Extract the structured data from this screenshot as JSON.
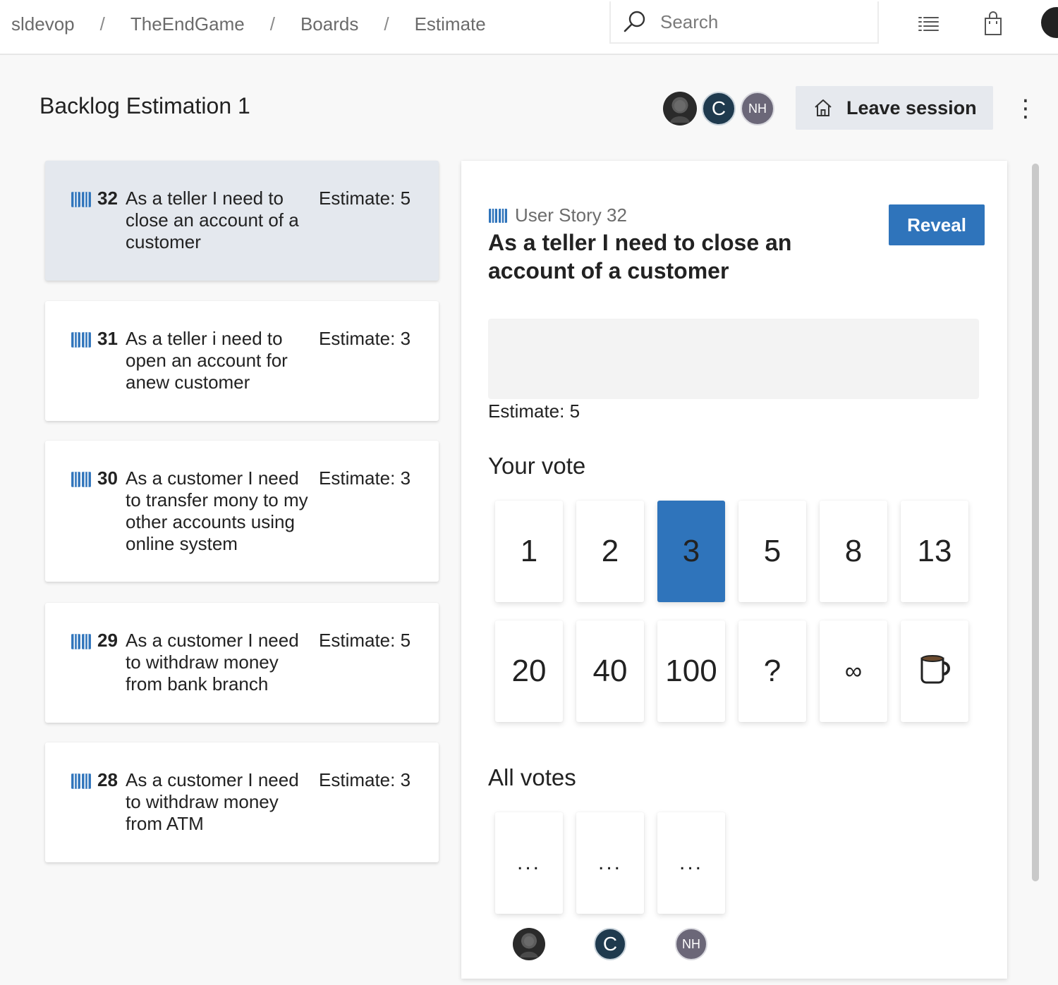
{
  "breadcrumb": [
    "sldevop",
    "TheEndGame",
    "Boards",
    "Estimate"
  ],
  "search": {
    "placeholder": "Search"
  },
  "topbar_icons": [
    "list-icon",
    "shopping-bag-icon",
    "user-avatar"
  ],
  "session": {
    "title": "Backlog Estimation 1",
    "participants": [
      {
        "type": "photo",
        "initials": ""
      },
      {
        "type": "initials",
        "initials": "C"
      },
      {
        "type": "initials",
        "initials": "NH"
      }
    ],
    "leave_label": "Leave session",
    "more_label": "⋮"
  },
  "backlog": [
    {
      "id": "32",
      "title": "As a teller I need to close an account of a customer",
      "estimate": "Estimate: 5",
      "selected": true
    },
    {
      "id": "31",
      "title": "As a teller i need to open an account for anew customer",
      "estimate": "Estimate: 3",
      "selected": false
    },
    {
      "id": "30",
      "title": "As a customer I need to transfer mony to my other accounts using online system",
      "estimate": "Estimate: 3",
      "selected": false
    },
    {
      "id": "29",
      "title": "As a customer I need to withdraw money from bank branch",
      "estimate": "Estimate: 5",
      "selected": false
    },
    {
      "id": "28",
      "title": "As a customer I need to withdraw money from ATM",
      "estimate": "Estimate: 3",
      "selected": false
    }
  ],
  "detail": {
    "type_label": "User Story 32",
    "title": "As a teller I need to close an account of a customer",
    "reveal_label": "Reveal",
    "estimate": "Estimate: 5",
    "your_vote_heading": "Your vote",
    "vote_cards": [
      "1",
      "2",
      "3",
      "5",
      "8",
      "13",
      "20",
      "40",
      "100",
      "?",
      "∞",
      "coffee-cup-icon"
    ],
    "selected_vote": "3",
    "all_votes_heading": "All votes",
    "all_votes": [
      {
        "value": "...",
        "voter": "",
        "voter_type": "photo"
      },
      {
        "value": "...",
        "voter": "C",
        "voter_type": "initials"
      },
      {
        "value": "...",
        "voter": "NH",
        "voter_type": "initials"
      }
    ]
  },
  "colors": {
    "accent": "#2f74bb",
    "selected_item_bg": "#e4e8ee",
    "book_icon": "#2f74bb"
  }
}
